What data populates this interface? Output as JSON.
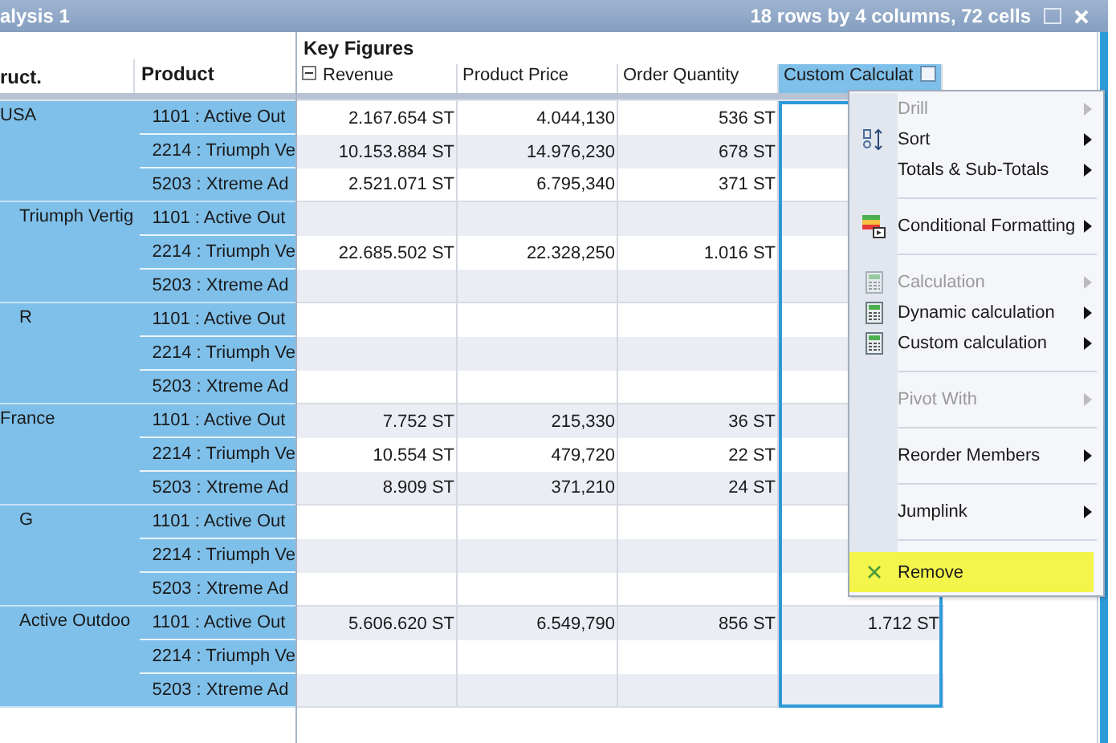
{
  "window": {
    "title": "alysis 1",
    "summary": "18 rows by 4 columns, 72 cells"
  },
  "table": {
    "group_label": "Key Figures",
    "row_headers": [
      "ruct.",
      "Product"
    ],
    "columns": [
      {
        "label": "Revenue",
        "collapsible": true,
        "selected": false
      },
      {
        "label": "Product Price",
        "collapsible": false,
        "selected": false
      },
      {
        "label": "Order Quantity",
        "collapsible": false,
        "selected": false
      },
      {
        "label": "Custom Calculat",
        "collapsible": false,
        "selected": true
      }
    ],
    "groups": [
      {
        "label": "USA",
        "indented": false,
        "rows": [
          {
            "product": "1101 : Active Out",
            "cells": [
              "2.167.654 ST",
              "4.044,130",
              "536 ST",
              null
            ]
          },
          {
            "product": "2214 : Triumph Ve",
            "cells": [
              "10.153.884 ST",
              "14.976,230",
              "678 ST",
              null
            ]
          },
          {
            "product": "5203 : Xtreme Ad",
            "cells": [
              "2.521.071 ST",
              "6.795,340",
              "371 ST",
              null
            ]
          }
        ]
      },
      {
        "label": "Triumph Vertig",
        "indented": true,
        "rows": [
          {
            "product": "1101 : Active Out",
            "cells": [
              null,
              null,
              null,
              null
            ]
          },
          {
            "product": "2214 : Triumph Ve",
            "cells": [
              "22.685.502 ST",
              "22.328,250",
              "1.016 ST",
              null
            ]
          },
          {
            "product": "5203 : Xtreme Ad",
            "cells": [
              null,
              null,
              null,
              null
            ]
          }
        ]
      },
      {
        "label": "R",
        "indented": true,
        "rows": [
          {
            "product": "1101 : Active Out",
            "cells": [
              null,
              null,
              null,
              null
            ]
          },
          {
            "product": "2214 : Triumph Ve",
            "cells": [
              null,
              null,
              null,
              null
            ]
          },
          {
            "product": "5203 : Xtreme Ad",
            "cells": [
              null,
              null,
              null,
              null
            ]
          }
        ]
      },
      {
        "label": "France",
        "indented": false,
        "rows": [
          {
            "product": "1101 : Active Out",
            "cells": [
              "7.752 ST",
              "215,330",
              "36 ST",
              null
            ]
          },
          {
            "product": "2214 : Triumph Ve",
            "cells": [
              "10.554 ST",
              "479,720",
              "22 ST",
              null
            ]
          },
          {
            "product": "5203 : Xtreme Ad",
            "cells": [
              "8.909 ST",
              "371,210",
              "24 ST",
              null
            ]
          }
        ]
      },
      {
        "label": "G",
        "indented": true,
        "rows": [
          {
            "product": "1101 : Active Out",
            "cells": [
              null,
              null,
              null,
              null
            ]
          },
          {
            "product": "2214 : Triumph Ve",
            "cells": [
              null,
              null,
              null,
              null
            ]
          },
          {
            "product": "5203 : Xtreme Ad",
            "cells": [
              null,
              null,
              null,
              null
            ]
          }
        ]
      },
      {
        "label": "Active Outdoo",
        "indented": true,
        "rows": [
          {
            "product": "1101 : Active Out",
            "cells": [
              "5.606.620 ST",
              "6.549,790",
              "856 ST",
              "1.712 ST"
            ]
          },
          {
            "product": "2214 : Triumph Ve",
            "cells": [
              null,
              null,
              null,
              null
            ]
          },
          {
            "product": "5203 : Xtreme Ad",
            "cells": [
              null,
              null,
              null,
              null
            ]
          }
        ]
      }
    ]
  },
  "context_menu": [
    {
      "kind": "item",
      "label": "Drill",
      "disabled": true,
      "submenu": true,
      "highlighted": false
    },
    {
      "kind": "sort",
      "label": "Sort",
      "disabled": false,
      "submenu": true,
      "highlighted": false
    },
    {
      "kind": "item",
      "label": "Totals & Sub-Totals",
      "disabled": false,
      "submenu": true,
      "highlighted": false
    },
    {
      "kind": "separator"
    },
    {
      "kind": "formatting",
      "label": "Conditional Formatting",
      "disabled": false,
      "submenu": true,
      "highlighted": false
    },
    {
      "kind": "separator"
    },
    {
      "kind": "calculation",
      "label": "Calculation",
      "disabled": true,
      "submenu": true,
      "highlighted": false
    },
    {
      "kind": "calculation",
      "label": "Dynamic calculation",
      "disabled": false,
      "submenu": true,
      "highlighted": false
    },
    {
      "kind": "calculation",
      "label": "Custom calculation",
      "disabled": false,
      "submenu": true,
      "highlighted": false
    },
    {
      "kind": "separator"
    },
    {
      "kind": "item",
      "label": "Pivot With",
      "disabled": true,
      "submenu": true,
      "highlighted": false
    },
    {
      "kind": "separator"
    },
    {
      "kind": "item",
      "label": "Reorder Members",
      "disabled": false,
      "submenu": true,
      "highlighted": false
    },
    {
      "kind": "separator"
    },
    {
      "kind": "item",
      "label": "Jumplink",
      "disabled": false,
      "submenu": true,
      "highlighted": false
    },
    {
      "kind": "separator"
    },
    {
      "kind": "remove",
      "label": "Remove",
      "disabled": false,
      "submenu": false,
      "highlighted": true
    }
  ]
}
